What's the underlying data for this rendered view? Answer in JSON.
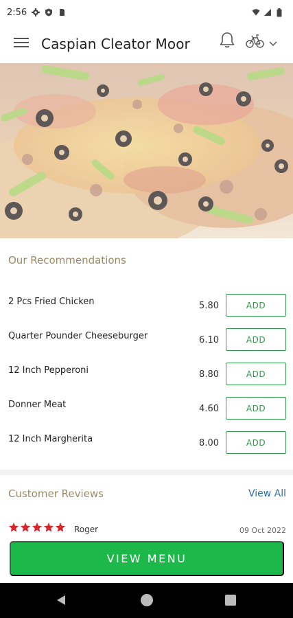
{
  "status_bar": {
    "time": "2:56",
    "icons": [
      "gear-icon",
      "shield-icon",
      "sim-card-icon",
      "wifi-icon",
      "signal-icon",
      "battery-icon"
    ]
  },
  "app_bar": {
    "title": "Caspian Cleator Moor",
    "icons": [
      "hamburger-menu-icon",
      "bell-icon",
      "bicycle-icon",
      "chevron-down-icon"
    ]
  },
  "hero": {
    "image": "pizza-photo"
  },
  "recommendations": {
    "title": "Our Recommendations",
    "items": [
      {
        "name": "2 Pcs Fried Chicken",
        "price": "5.80",
        "button": "ADD"
      },
      {
        "name": "Quarter Pounder Cheeseburger",
        "price": "6.10",
        "button": "ADD"
      },
      {
        "name": "12 Inch Pepperoni",
        "price": "8.80",
        "button": "ADD"
      },
      {
        "name": "Donner Meat",
        "price": "4.60",
        "button": "ADD"
      },
      {
        "name": "12 Inch Margherita",
        "price": "8.00",
        "button": "ADD"
      }
    ]
  },
  "reviews": {
    "title": "Customer Reviews",
    "view_all": "View All",
    "items": [
      {
        "rating": 5,
        "reviewer": "Roger",
        "date": "09 Oct 2022"
      }
    ]
  },
  "cta": {
    "label": "VIEW MENU"
  },
  "colors": {
    "accent_green": "#1cb84a",
    "add_button_green": "#2f9b4a",
    "section_title": "#9b8a63",
    "link_blue": "#2b6cb0",
    "star_red": "#d7262e"
  }
}
